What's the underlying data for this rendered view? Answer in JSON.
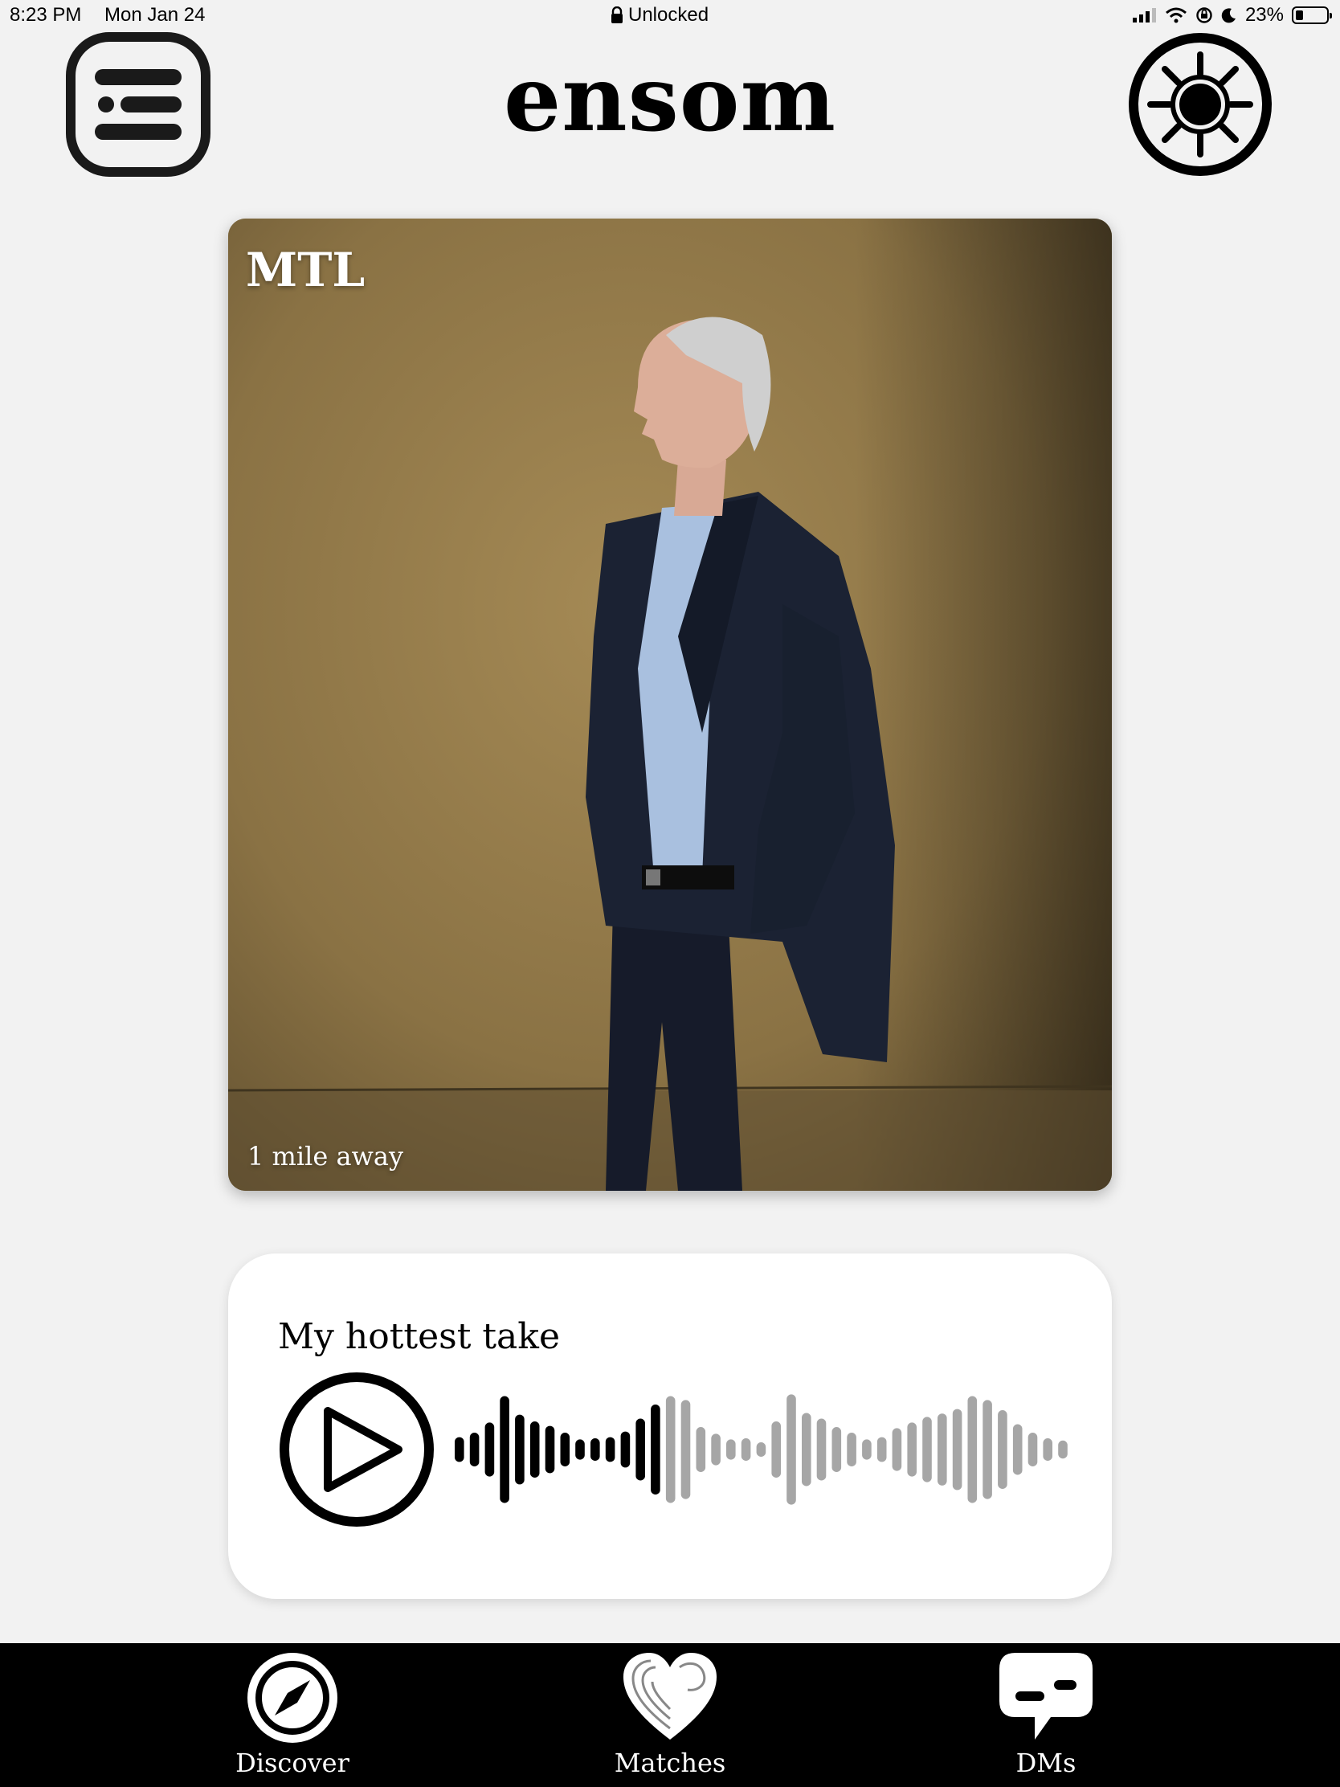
{
  "status_bar": {
    "time": "8:23 PM",
    "date": "Mon Jan 24",
    "lock_status": "Unlocked",
    "battery_percent": "23%",
    "battery_level": 0.23,
    "icons": [
      "lock-icon",
      "signal-icon",
      "wifi-icon",
      "orientation-lock-icon",
      "moon-icon",
      "battery-icon"
    ]
  },
  "header": {
    "app_title": "ensom",
    "menu_icon": "menu-icon",
    "settings_icon": "sun-settings-icon"
  },
  "profile": {
    "name": "MTL",
    "distance": "1 mile away",
    "photo": "man-in-suit-profile-photo"
  },
  "audio_prompt": {
    "title": "My hottest take",
    "play_icon": "play-icon",
    "progress": 0.32
  },
  "bottom_nav": {
    "items": [
      {
        "label": "Discover",
        "icon": "compass-icon"
      },
      {
        "label": "Matches",
        "icon": "heart-icon"
      },
      {
        "label": "DMs",
        "icon": "chat-bubble-icon"
      }
    ]
  },
  "colors": {
    "background": "#f2f2f2",
    "nav_background": "#000000",
    "waveform_played": "#000000",
    "waveform_unplayed": "#a6a6a6"
  }
}
